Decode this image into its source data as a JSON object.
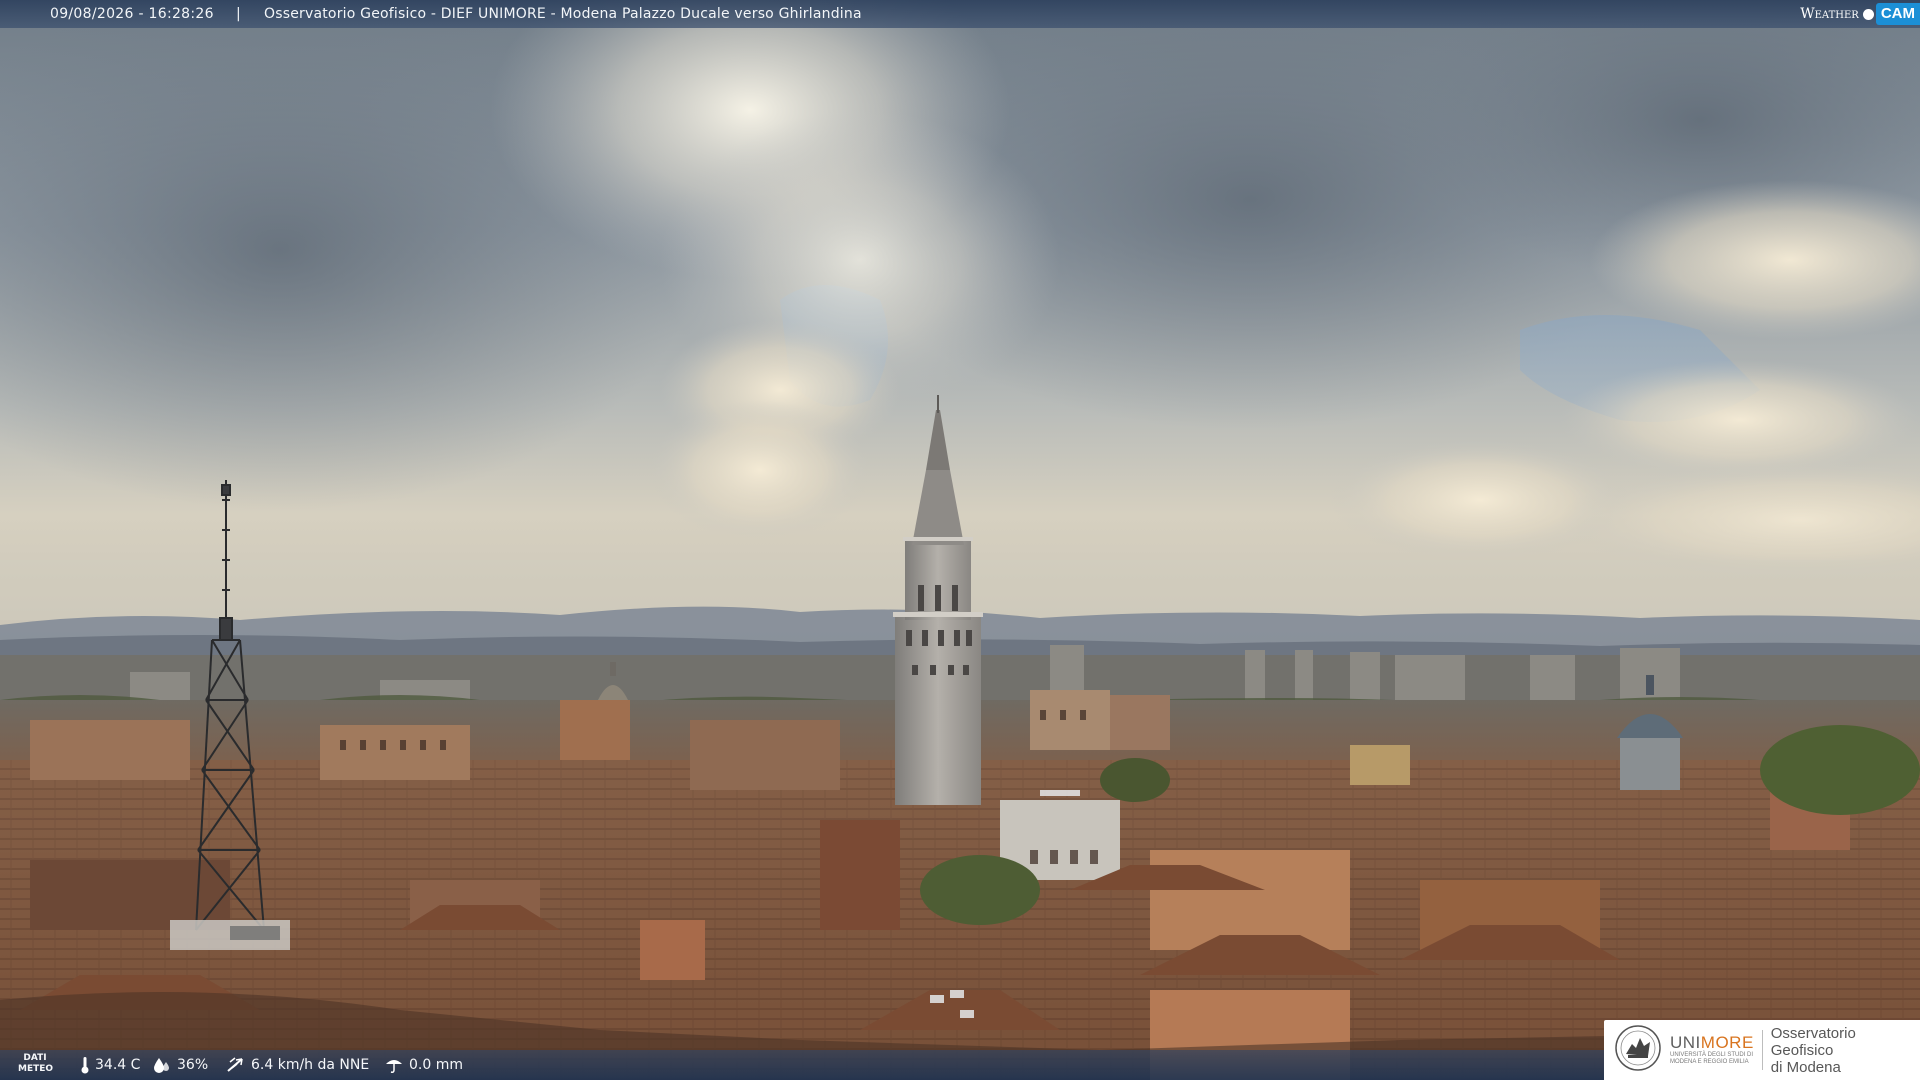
{
  "header": {
    "timestamp": "09/08/2026 - 16:28:26",
    "separator": "|",
    "camera_title": "Osservatorio Geofisico - DIEF UNIMORE - Modena Palazzo Ducale verso Ghirlandina"
  },
  "brand": {
    "weather_word": "Weather",
    "cam_word": "CAM",
    "accent_color": "#1c8fd6"
  },
  "weather": {
    "label_line1": "DATI",
    "label_line2": "METEO",
    "temperature": "34.4 C",
    "humidity": "36%",
    "wind": "6.4 km/h da NNE",
    "rain": "0.0 mm",
    "icons": [
      "thermometer-icon",
      "humidity-icon",
      "wind-icon",
      "rain-gauge-icon"
    ]
  },
  "logo": {
    "wordmark_plain": "UNI",
    "wordmark_accent": "MORE",
    "subline1": "UNIVERSITÀ DEGLI STUDI DI",
    "subline2": "MODENA E REGGIO EMILIA",
    "observatory_line1": "Osservatorio Geofisico",
    "observatory_line2": "di Modena",
    "accent_color": "#d8741f"
  },
  "scene": {
    "subject": "Modena skyline with Ghirlandina tower under cumulus clouds",
    "sky_top_color": "#7e8a96",
    "sky_horizon_color": "#d8cfbc",
    "roof_color": "#8a5a3e"
  }
}
